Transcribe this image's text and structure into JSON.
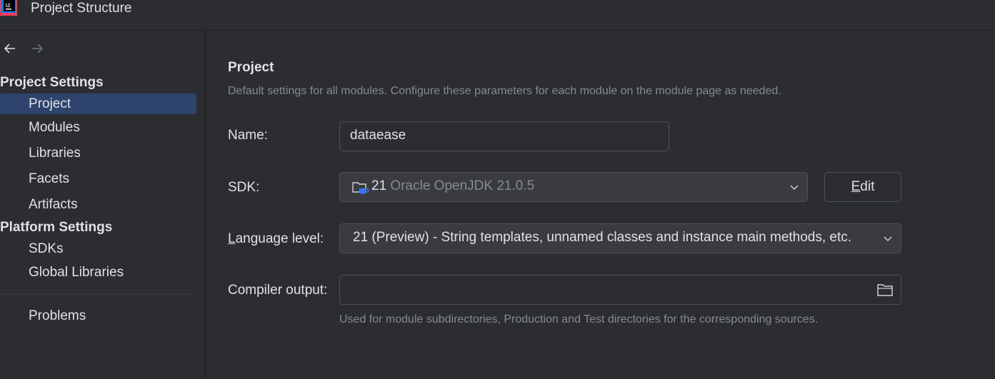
{
  "window": {
    "title": "Project Structure"
  },
  "sidebar": {
    "project_settings_heading": "Project Settings",
    "project_items": [
      {
        "label": "Project",
        "selected": true
      },
      {
        "label": "Modules"
      },
      {
        "label": "Libraries"
      },
      {
        "label": "Facets"
      },
      {
        "label": "Artifacts"
      }
    ],
    "platform_settings_heading": "Platform Settings",
    "platform_items": [
      {
        "label": "SDKs"
      },
      {
        "label": "Global Libraries"
      }
    ],
    "problems_label": "Problems"
  },
  "main": {
    "heading": "Project",
    "description": "Default settings for all modules. Configure these parameters for each module on the module page as needed.",
    "name_label": "Name:",
    "name_value": "dataease",
    "sdk_label": "SDK:",
    "sdk_major": "21",
    "sdk_name": "Oracle OpenJDK 21.0.5",
    "edit_button_prefix": "E",
    "edit_button_rest": "dit",
    "language_label_prefix": "L",
    "language_label_rest": "anguage level:",
    "language_value": "21 (Preview) - String templates, unnamed classes and instance main methods, etc.",
    "compiler_label": "Compiler output:",
    "compiler_value": "",
    "compiler_hint": "Used for module subdirectories, Production and Test directories for the corresponding sources."
  },
  "icons": {
    "app": "intellij-idea-icon",
    "back": "arrow-left-icon",
    "forward": "arrow-right-icon",
    "sdk": "jdk-folder-icon",
    "dropdown": "chevron-down-icon",
    "browse": "folder-icon"
  },
  "colors": {
    "background": "#2b2d30",
    "selection": "#2e436e",
    "muted_text": "#868a91",
    "text": "#dfe1e5"
  }
}
